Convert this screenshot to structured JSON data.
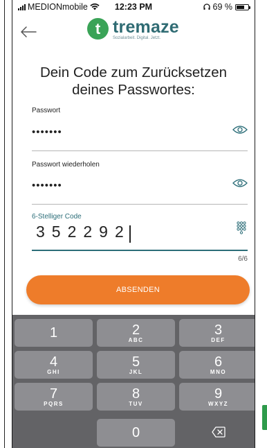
{
  "status_bar": {
    "carrier": "MEDIONmobile",
    "time": "12:23 PM",
    "battery": "69 %",
    "battery_level": 0.69
  },
  "header": {
    "logo_letter": "t",
    "logo_name": "tremaze",
    "logo_tagline": "Sozialarbeit. Digital. Jetzt."
  },
  "title": "Dein Code zum Zurücksetzen deines Passwortes:",
  "fields": {
    "password": {
      "label": "Passwort",
      "value": "•••••••"
    },
    "password_repeat": {
      "label": "Passwort wiederholen",
      "value": "•••••••"
    },
    "code": {
      "label": "6-Stelliger Code",
      "value": "352292",
      "counter": "6/6"
    }
  },
  "submit_label": "ABSENDEN",
  "keyboard": {
    "keys": [
      {
        "num": "1",
        "letters": ""
      },
      {
        "num": "2",
        "letters": "ABC"
      },
      {
        "num": "3",
        "letters": "DEF"
      },
      {
        "num": "4",
        "letters": "GHI"
      },
      {
        "num": "5",
        "letters": "JKL"
      },
      {
        "num": "6",
        "letters": "MNO"
      },
      {
        "num": "7",
        "letters": "PQRS"
      },
      {
        "num": "8",
        "letters": "TUV"
      },
      {
        "num": "9",
        "letters": "WXYZ"
      },
      {
        "num": "0",
        "letters": ""
      }
    ]
  },
  "colors": {
    "accent_orange": "#ee7c2a",
    "brand_green": "#3aa357",
    "brand_teal": "#2f6b73",
    "keyboard_bg": "#636366",
    "key_bg": "#8e8e92"
  }
}
